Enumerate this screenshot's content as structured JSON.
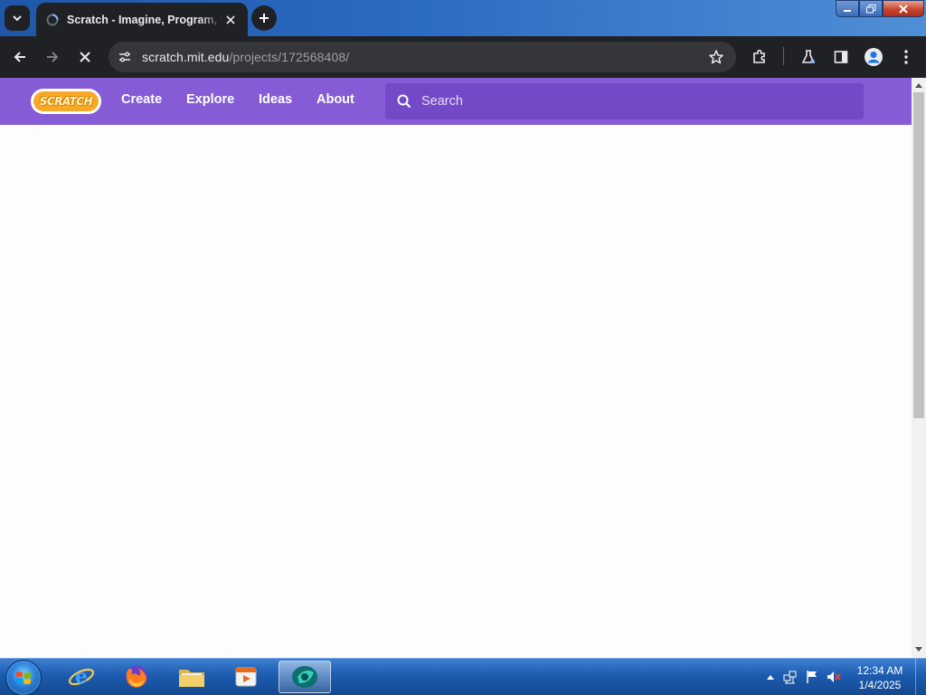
{
  "browser": {
    "tab": {
      "title": "Scratch - Imagine, Program, Share"
    },
    "address_bar": {
      "host": "scratch.mit.edu",
      "path": "/projects/172568408/"
    }
  },
  "scratch": {
    "logo_text": "SCRATCH",
    "nav": {
      "create": "Create",
      "explore": "Explore",
      "ideas": "Ideas",
      "about": "About"
    },
    "search": {
      "placeholder": "Search",
      "value": ""
    }
  },
  "taskbar": {
    "clock": {
      "time": "12:34 AM",
      "date": "1/4/2025"
    }
  },
  "colors": {
    "scratch_nav": "#855cd6",
    "scratch_search": "#7349c7",
    "browser_chrome": "#202124"
  }
}
